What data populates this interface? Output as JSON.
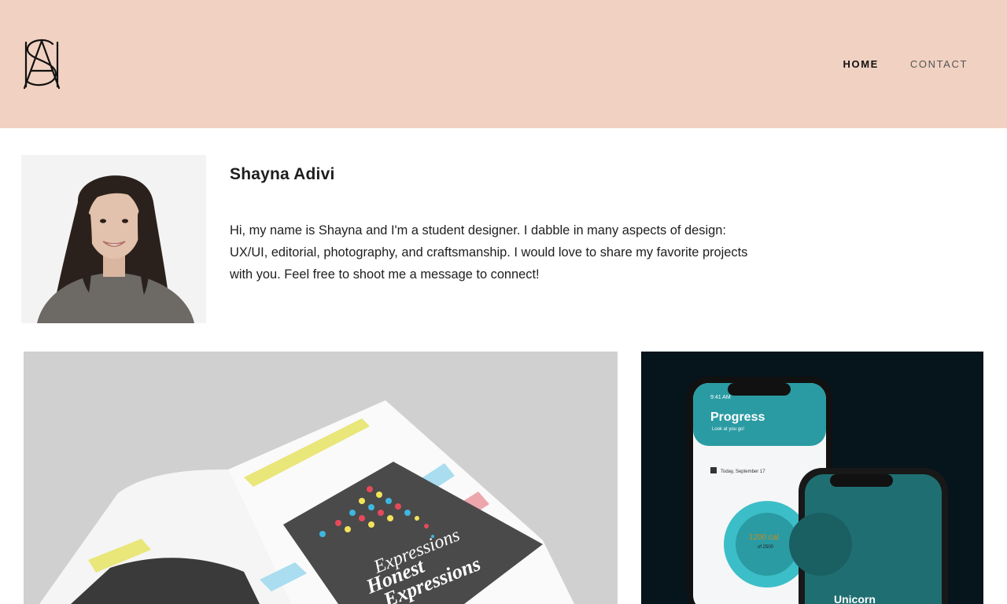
{
  "header": {
    "background": "#f1d1c1",
    "logo_initials": "SA",
    "nav": [
      {
        "label": "HOME",
        "active": true
      },
      {
        "label": "CONTACT",
        "active": false
      }
    ]
  },
  "intro": {
    "name": "Shayna Adivi",
    "bio": "Hi, my name is Shayna and I'm a student designer. I dabble in many aspects of design: UX/UI, editorial, photography, and craftsmanship. I would love to share my favorite projects with you. Feel free to shoot me a message to connect!"
  },
  "projects": {
    "magazine": {
      "cover_title_line1": "Honest",
      "cover_title_line2": "Expressions"
    },
    "app": {
      "time": "9:41 AM",
      "title": "Progress",
      "subtitle": "Look at you go!",
      "date": "Today, September 17",
      "calories": "1200 cal",
      "calories_goal": "of 2500",
      "next_title": "Unicorn"
    }
  }
}
